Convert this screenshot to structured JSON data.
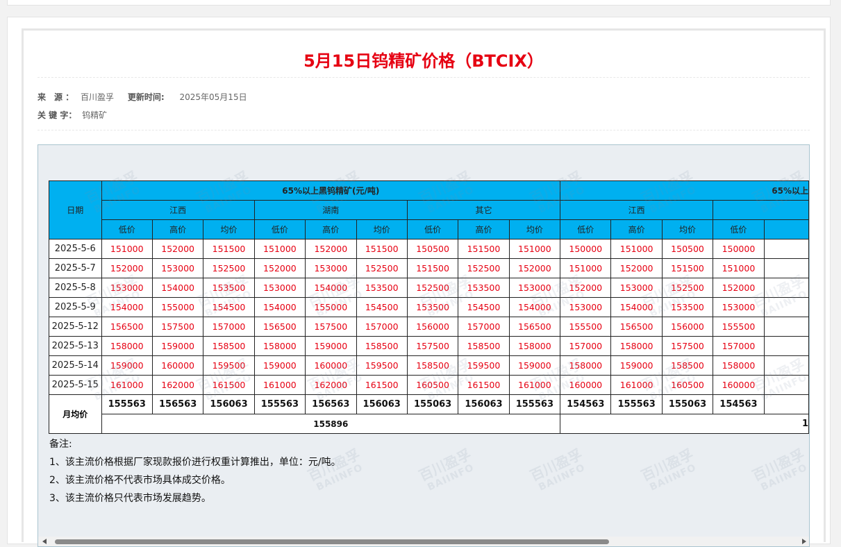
{
  "article": {
    "title": "5月15日钨精矿价格（BTCIX）",
    "source_label": "来　源 ：",
    "source_value": "百川盈孚",
    "update_label": "更新时间:",
    "update_value": "2025年05月15日",
    "keywords_label": "关 键 字：",
    "keywords_value": "钨精矿"
  },
  "table": {
    "date_header": "日期",
    "group1": "65%以上黑钨精矿(元/吨)",
    "group2": "65%以上",
    "regions1": [
      "江西",
      "湖南",
      "其它"
    ],
    "regions2": [
      "江西"
    ],
    "price_labels": [
      "低价",
      "高价",
      "均价"
    ],
    "rows": [
      {
        "date": "2025-5-6",
        "values": [
          "151000",
          "152000",
          "151500",
          "151000",
          "152000",
          "151500",
          "150500",
          "151500",
          "151000",
          "150000",
          "151000",
          "150500",
          "150000"
        ]
      },
      {
        "date": "2025-5-7",
        "values": [
          "152000",
          "153000",
          "152500",
          "152000",
          "153000",
          "152500",
          "151500",
          "152500",
          "152000",
          "151000",
          "152000",
          "151500",
          "151000"
        ]
      },
      {
        "date": "2025-5-8",
        "values": [
          "153000",
          "154000",
          "153500",
          "153000",
          "154000",
          "153500",
          "152500",
          "153500",
          "153000",
          "152000",
          "153000",
          "152500",
          "152000"
        ]
      },
      {
        "date": "2025-5-9",
        "values": [
          "154000",
          "155000",
          "154500",
          "154000",
          "155000",
          "154500",
          "153500",
          "154500",
          "154000",
          "153000",
          "154000",
          "153500",
          "153000"
        ]
      },
      {
        "date": "2025-5-12",
        "values": [
          "156500",
          "157500",
          "157000",
          "156500",
          "157500",
          "157000",
          "156000",
          "157000",
          "156500",
          "155500",
          "156500",
          "156000",
          "155500"
        ]
      },
      {
        "date": "2025-5-13",
        "values": [
          "158000",
          "159000",
          "158500",
          "158000",
          "159000",
          "158500",
          "157500",
          "158500",
          "158000",
          "157000",
          "158000",
          "157500",
          "157000"
        ]
      },
      {
        "date": "2025-5-14",
        "values": [
          "159000",
          "160000",
          "159500",
          "159000",
          "160000",
          "159500",
          "158500",
          "159500",
          "159000",
          "158000",
          "159000",
          "158500",
          "158000"
        ]
      },
      {
        "date": "2025-5-15",
        "values": [
          "161000",
          "162000",
          "161500",
          "161000",
          "162000",
          "161500",
          "160500",
          "161500",
          "161000",
          "160000",
          "161000",
          "160500",
          "160000"
        ]
      }
    ],
    "monthly_label": "月均价",
    "monthly_values": [
      "155563",
      "156563",
      "156063",
      "155563",
      "156563",
      "156063",
      "155063",
      "156063",
      "155563",
      "154563",
      "155563",
      "155063",
      "154563"
    ],
    "monthly_overall": "155896",
    "monthly_overall2": "1"
  },
  "notes": {
    "heading": "备注:",
    "lines": [
      "1、该主流价格根据厂家现款报价进行权重计算推出，单位：元/吨。",
      "2、该主流价格不代表市场具体成交价格。",
      "3、该主流价格只代表市场发展趋势。"
    ]
  },
  "watermark": {
    "line1": "百川盈孚",
    "line2": "BAIINFO"
  }
}
